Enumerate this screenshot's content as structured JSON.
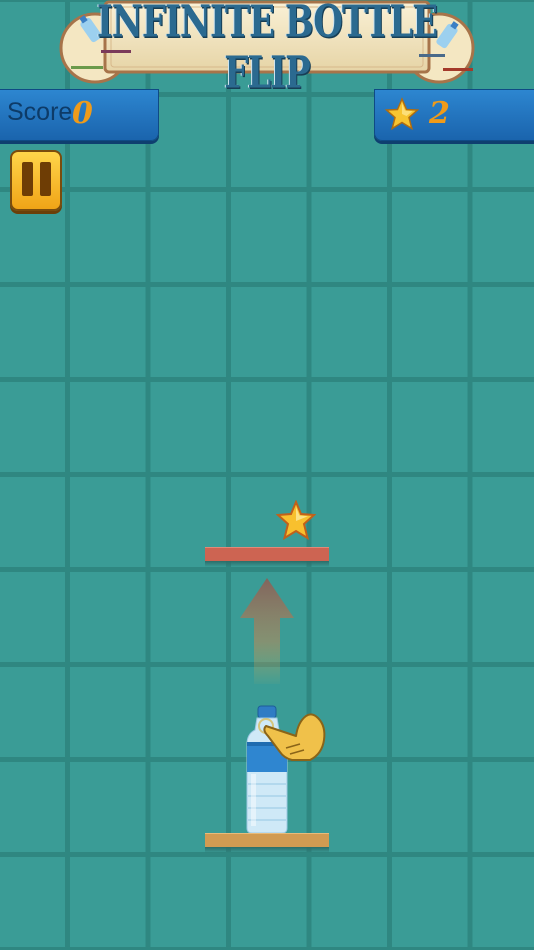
{
  "game": {
    "title": "INFINITE BOTTLE FLIP",
    "score_label": "Score",
    "score_value": "0",
    "stars_value": "2"
  },
  "icons": {
    "pause": "pause-icon",
    "star": "star-icon",
    "bottle": "water-bottle",
    "hand": "tap-hand-icon",
    "arrow": "up-arrow-hint"
  },
  "colors": {
    "background": "#3a9c96",
    "grid": "#2f8781",
    "panel": "#1f70bb",
    "accent": "#ef9b1a",
    "platform_top": "#cd6452",
    "platform_bottom": "#d19b52"
  }
}
